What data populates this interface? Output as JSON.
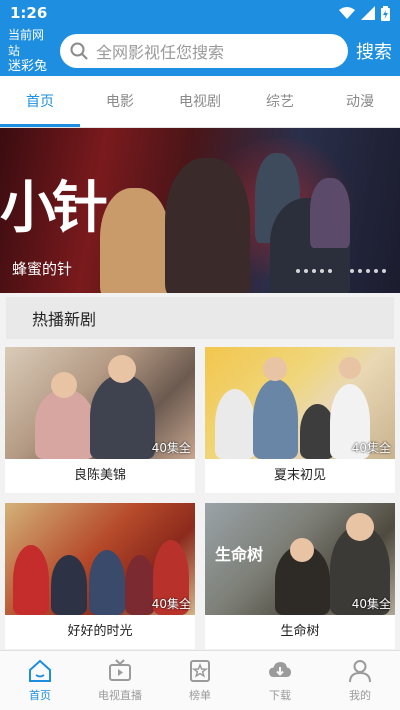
{
  "status": {
    "time": "1:26"
  },
  "header": {
    "site_label": "当前网站",
    "site_name": "迷彩兔",
    "search_placeholder": "全网影视任您搜索",
    "search_button": "搜索"
  },
  "tabs": [
    {
      "label": "首页",
      "active": true
    },
    {
      "label": "电影"
    },
    {
      "label": "电视剧"
    },
    {
      "label": "综艺"
    },
    {
      "label": "动漫"
    }
  ],
  "banner": {
    "title": "蜂蜜的针",
    "logo_text": "小针"
  },
  "section": {
    "title": "热播新剧"
  },
  "cards": [
    {
      "title": "良陈美锦",
      "badge": "40集全"
    },
    {
      "title": "夏末初见",
      "badge": "40集全"
    },
    {
      "title": "好好的时光",
      "badge": "40集全"
    },
    {
      "title": "生命树",
      "badge": "40集全"
    }
  ],
  "nav": [
    {
      "label": "首页",
      "icon": "home-icon",
      "active": true
    },
    {
      "label": "电视直播",
      "icon": "tv-icon"
    },
    {
      "label": "榜单",
      "icon": "ranking-icon"
    },
    {
      "label": "下载",
      "icon": "cloud-download-icon"
    },
    {
      "label": "我的",
      "icon": "user-icon"
    }
  ],
  "colors": {
    "accent": "#1e8fe0",
    "inactive": "#9b9b9b"
  }
}
